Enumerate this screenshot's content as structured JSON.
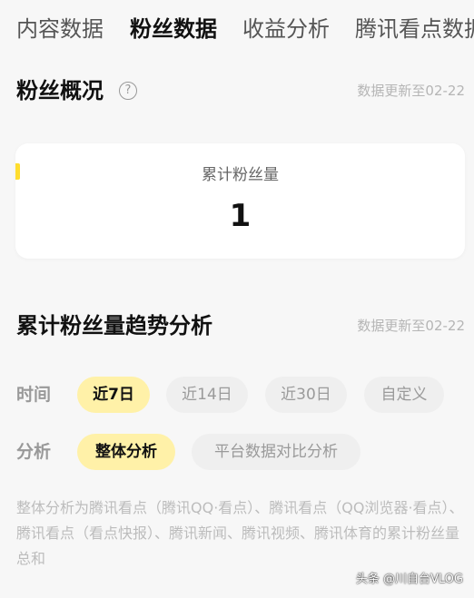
{
  "tabs": [
    {
      "label": "内容数据",
      "active": false
    },
    {
      "label": "粉丝数据",
      "active": true
    },
    {
      "label": "收益分析",
      "active": false
    },
    {
      "label": "腾讯看点数据",
      "active": false
    }
  ],
  "overview": {
    "title": "粉丝概况",
    "help_icon": "?",
    "update_text": "数据更新至02-22",
    "card": {
      "label": "累计粉丝量",
      "value": "1"
    }
  },
  "trend": {
    "title": "累计粉丝量趋势分析",
    "update_text": "数据更新至02-22",
    "time_label": "时间",
    "time_options": [
      {
        "label": "近7日",
        "active": true
      },
      {
        "label": "近14日",
        "active": false
      },
      {
        "label": "近30日",
        "active": false
      },
      {
        "label": "自定义",
        "active": false
      }
    ],
    "analysis_label": "分析",
    "analysis_options": [
      {
        "label": "整体分析",
        "active": true
      },
      {
        "label": "平台数据对比分析",
        "active": false
      }
    ],
    "description": "整体分析为腾讯看点（腾讯QQ·看点）、腾讯看点（QQ浏览器·看点）、腾讯看点（看点快报）、腾讯新闻、腾讯视频、腾讯体育的累计粉丝量总和"
  },
  "watermark": "头条 @川自台VLOG",
  "colors": {
    "accent_yellow": "#ffdd2e",
    "chip_active_bg": "#fff1a8",
    "chip_bg": "#efefef",
    "page_bg": "#f7f7f7"
  }
}
